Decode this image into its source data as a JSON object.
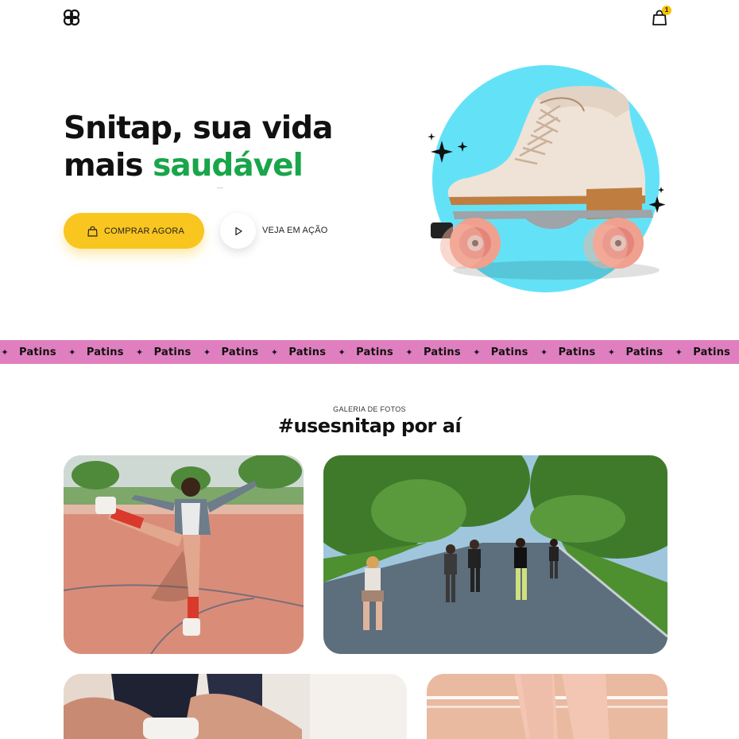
{
  "header": {
    "logo_icon": "logo-knot-icon",
    "cart_icon": "shopping-bag-icon",
    "cart_count": "1"
  },
  "hero": {
    "title_line1": "Snitap, sua vida",
    "title_line2_plain": "mais",
    "title_line2_accent": "saudável",
    "accent_color": "#19a54a",
    "buy_button_label": "COMPRAR AGORA",
    "buy_button_color": "#f9c51f",
    "play_button_label": "VEJA EM AÇÃO",
    "image_alt": "roller-skate",
    "circle_color": "#63e2f7"
  },
  "marquee": {
    "background": "#e07fbf",
    "items": [
      "Patins",
      "Patins",
      "Patins",
      "Patins",
      "Patins",
      "Patins",
      "Patins",
      "Patins",
      "Patins",
      "Patins",
      "Patins",
      "Patins"
    ]
  },
  "gallery": {
    "eyebrow": "GALERIA DE FOTOS",
    "title": "#usesnitap por aí",
    "photos": [
      {
        "name": "woman-skating-court-photo"
      },
      {
        "name": "group-skating-park-photo"
      },
      {
        "name": "lacing-skates-photo"
      },
      {
        "name": "legs-on-court-photo"
      }
    ]
  }
}
